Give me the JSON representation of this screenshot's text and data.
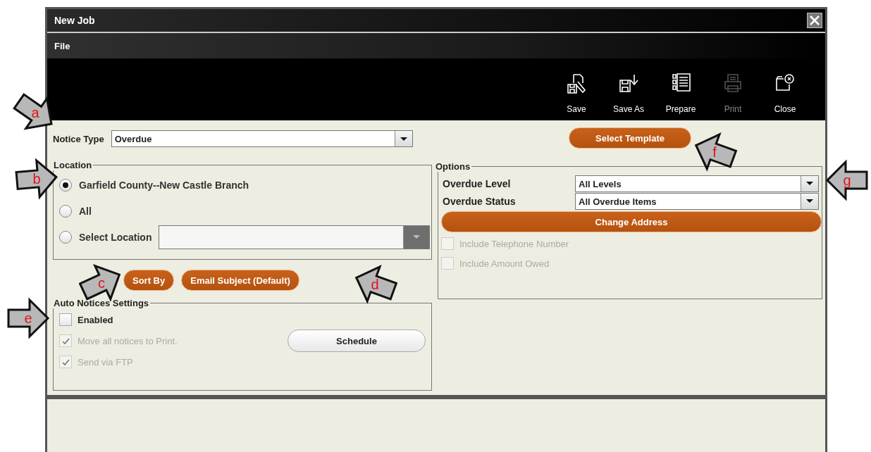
{
  "window": {
    "title": "New Job"
  },
  "menu": [
    {
      "label": "File"
    }
  ],
  "toolbar": [
    {
      "label": "Save",
      "disabled": false
    },
    {
      "label": "Save As",
      "disabled": false
    },
    {
      "label": "Prepare",
      "disabled": false
    },
    {
      "label": "Print",
      "disabled": true
    },
    {
      "label": "Close",
      "disabled": false
    }
  ],
  "notice_type": {
    "label": "Notice Type",
    "value": "Overdue"
  },
  "select_template_button": "Select Template",
  "location": {
    "legend": "Location",
    "options": [
      {
        "label": "Garfield County--New Castle Branch",
        "selected": true
      },
      {
        "label": "All",
        "selected": false
      },
      {
        "label": "Select Location",
        "selected": false
      }
    ],
    "select_field": {
      "disabled": true
    }
  },
  "action_buttons": [
    "Sort By",
    "Email Subject (Default)"
  ],
  "auto_notices": {
    "legend": "Auto Notices Settings",
    "checkboxes": [
      {
        "label": "Enabled",
        "checked": false,
        "disabled": false
      },
      {
        "label": "Move all notices to Print.",
        "checked": true,
        "disabled": true
      },
      {
        "label": "Send via FTP",
        "checked": true,
        "disabled": true
      }
    ],
    "schedule_button": "Schedule"
  },
  "options": {
    "legend": "Options",
    "fields": [
      {
        "label": "Overdue Level",
        "value": "All Levels"
      },
      {
        "label": "Overdue Status",
        "value": "All Overdue Items"
      }
    ],
    "change_address_button": "Change Address",
    "checkboxes": [
      {
        "label": "Include Telephone Number",
        "checked": false,
        "disabled": true
      },
      {
        "label": "Include Amount Owed",
        "checked": false,
        "disabled": true
      }
    ]
  },
  "callouts": [
    {
      "letter": "a"
    },
    {
      "letter": "b"
    },
    {
      "letter": "c"
    },
    {
      "letter": "d"
    },
    {
      "letter": "e"
    },
    {
      "letter": "f"
    },
    {
      "letter": "g"
    }
  ]
}
